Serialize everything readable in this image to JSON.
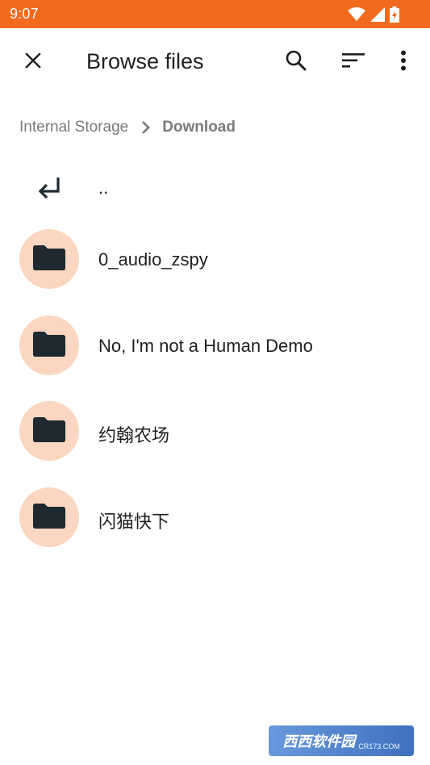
{
  "status_bar": {
    "time": "9:07",
    "color": "#f26b1d",
    "icons": [
      "wifi-icon",
      "signal-icon",
      "battery-charging-icon"
    ]
  },
  "app_bar": {
    "title": "Browse files",
    "actions": [
      "close-icon",
      "search-icon",
      "sort-icon",
      "more-vert-icon"
    ]
  },
  "breadcrumb": {
    "root": "Internal Storage",
    "current": "Download"
  },
  "list": {
    "parent_label": "..",
    "folders": [
      {
        "name": "0_audio_zspy"
      },
      {
        "name": "No, I'm not a Human Demo"
      },
      {
        "name": "约翰农场"
      },
      {
        "name": "闪猫快下"
      }
    ]
  },
  "watermark": {
    "logo": "西西软件园",
    "url": "CR173.COM"
  },
  "colors": {
    "accent": "#f26b1d",
    "folder_bg": "#fbd6c1",
    "icon_dark": "#1f2a30",
    "secondary_text": "#7a7a7a"
  }
}
